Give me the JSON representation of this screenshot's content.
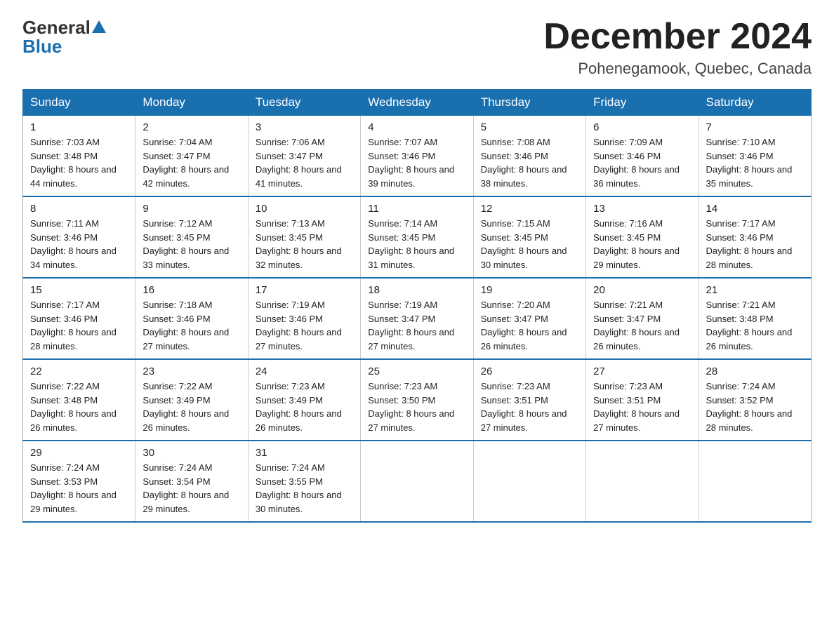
{
  "header": {
    "logo_general": "General",
    "logo_blue": "Blue",
    "month_title": "December 2024",
    "location": "Pohenegamook, Quebec, Canada"
  },
  "days_of_week": [
    "Sunday",
    "Monday",
    "Tuesday",
    "Wednesday",
    "Thursday",
    "Friday",
    "Saturday"
  ],
  "weeks": [
    [
      {
        "day": "1",
        "sunrise": "7:03 AM",
        "sunset": "3:48 PM",
        "daylight": "8 hours and 44 minutes."
      },
      {
        "day": "2",
        "sunrise": "7:04 AM",
        "sunset": "3:47 PM",
        "daylight": "8 hours and 42 minutes."
      },
      {
        "day": "3",
        "sunrise": "7:06 AM",
        "sunset": "3:47 PM",
        "daylight": "8 hours and 41 minutes."
      },
      {
        "day": "4",
        "sunrise": "7:07 AM",
        "sunset": "3:46 PM",
        "daylight": "8 hours and 39 minutes."
      },
      {
        "day": "5",
        "sunrise": "7:08 AM",
        "sunset": "3:46 PM",
        "daylight": "8 hours and 38 minutes."
      },
      {
        "day": "6",
        "sunrise": "7:09 AM",
        "sunset": "3:46 PM",
        "daylight": "8 hours and 36 minutes."
      },
      {
        "day": "7",
        "sunrise": "7:10 AM",
        "sunset": "3:46 PM",
        "daylight": "8 hours and 35 minutes."
      }
    ],
    [
      {
        "day": "8",
        "sunrise": "7:11 AM",
        "sunset": "3:46 PM",
        "daylight": "8 hours and 34 minutes."
      },
      {
        "day": "9",
        "sunrise": "7:12 AM",
        "sunset": "3:45 PM",
        "daylight": "8 hours and 33 minutes."
      },
      {
        "day": "10",
        "sunrise": "7:13 AM",
        "sunset": "3:45 PM",
        "daylight": "8 hours and 32 minutes."
      },
      {
        "day": "11",
        "sunrise": "7:14 AM",
        "sunset": "3:45 PM",
        "daylight": "8 hours and 31 minutes."
      },
      {
        "day": "12",
        "sunrise": "7:15 AM",
        "sunset": "3:45 PM",
        "daylight": "8 hours and 30 minutes."
      },
      {
        "day": "13",
        "sunrise": "7:16 AM",
        "sunset": "3:45 PM",
        "daylight": "8 hours and 29 minutes."
      },
      {
        "day": "14",
        "sunrise": "7:17 AM",
        "sunset": "3:46 PM",
        "daylight": "8 hours and 28 minutes."
      }
    ],
    [
      {
        "day": "15",
        "sunrise": "7:17 AM",
        "sunset": "3:46 PM",
        "daylight": "8 hours and 28 minutes."
      },
      {
        "day": "16",
        "sunrise": "7:18 AM",
        "sunset": "3:46 PM",
        "daylight": "8 hours and 27 minutes."
      },
      {
        "day": "17",
        "sunrise": "7:19 AM",
        "sunset": "3:46 PM",
        "daylight": "8 hours and 27 minutes."
      },
      {
        "day": "18",
        "sunrise": "7:19 AM",
        "sunset": "3:47 PM",
        "daylight": "8 hours and 27 minutes."
      },
      {
        "day": "19",
        "sunrise": "7:20 AM",
        "sunset": "3:47 PM",
        "daylight": "8 hours and 26 minutes."
      },
      {
        "day": "20",
        "sunrise": "7:21 AM",
        "sunset": "3:47 PM",
        "daylight": "8 hours and 26 minutes."
      },
      {
        "day": "21",
        "sunrise": "7:21 AM",
        "sunset": "3:48 PM",
        "daylight": "8 hours and 26 minutes."
      }
    ],
    [
      {
        "day": "22",
        "sunrise": "7:22 AM",
        "sunset": "3:48 PM",
        "daylight": "8 hours and 26 minutes."
      },
      {
        "day": "23",
        "sunrise": "7:22 AM",
        "sunset": "3:49 PM",
        "daylight": "8 hours and 26 minutes."
      },
      {
        "day": "24",
        "sunrise": "7:23 AM",
        "sunset": "3:49 PM",
        "daylight": "8 hours and 26 minutes."
      },
      {
        "day": "25",
        "sunrise": "7:23 AM",
        "sunset": "3:50 PM",
        "daylight": "8 hours and 27 minutes."
      },
      {
        "day": "26",
        "sunrise": "7:23 AM",
        "sunset": "3:51 PM",
        "daylight": "8 hours and 27 minutes."
      },
      {
        "day": "27",
        "sunrise": "7:23 AM",
        "sunset": "3:51 PM",
        "daylight": "8 hours and 27 minutes."
      },
      {
        "day": "28",
        "sunrise": "7:24 AM",
        "sunset": "3:52 PM",
        "daylight": "8 hours and 28 minutes."
      }
    ],
    [
      {
        "day": "29",
        "sunrise": "7:24 AM",
        "sunset": "3:53 PM",
        "daylight": "8 hours and 29 minutes."
      },
      {
        "day": "30",
        "sunrise": "7:24 AM",
        "sunset": "3:54 PM",
        "daylight": "8 hours and 29 minutes."
      },
      {
        "day": "31",
        "sunrise": "7:24 AM",
        "sunset": "3:55 PM",
        "daylight": "8 hours and 30 minutes."
      },
      null,
      null,
      null,
      null
    ]
  ]
}
